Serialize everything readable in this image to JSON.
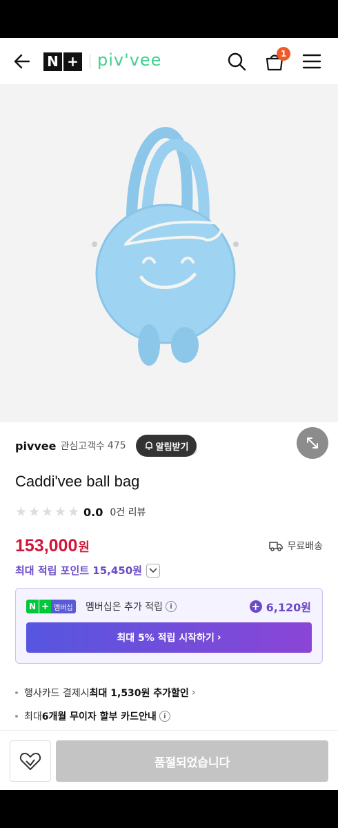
{
  "header": {
    "nplus_logo": "N+",
    "brand_logo": "piv'vee",
    "cart_count": "1"
  },
  "gallery": {
    "dots_total": 4,
    "active_index": 0
  },
  "seller": {
    "name": "pivvee",
    "follower_label": "관심고객수",
    "follower_count": "475",
    "alarm_label": "알림받기"
  },
  "product": {
    "title": "Caddi'vee ball bag",
    "rating": "0.0",
    "review_count": "0건 리뷰",
    "stars_filled": 0,
    "price": "153,000",
    "currency": "원",
    "shipping": "무료배송",
    "max_points": "최대 적립 포인트 15,450원"
  },
  "membership": {
    "badge_n": "N",
    "badge_plus": "+",
    "badge_label": "멤버십",
    "description": "멤버십은 추가 적립",
    "points": "6,120원",
    "cta": "최대 5% 적립 시작하기"
  },
  "benefits": {
    "card_prefix": "행사카드 결제시 ",
    "card_bold": "최대 1,530원 추가할인",
    "installment_prefix": "최대 ",
    "installment_bold": "6개월 무이자 할부 카드안내"
  },
  "bottom": {
    "soldout_label": "품절되었습니다"
  },
  "colors": {
    "price": "#d0173a",
    "points": "#6b4ac6",
    "brand": "#3fcf8e",
    "badge": "#f05a28"
  }
}
